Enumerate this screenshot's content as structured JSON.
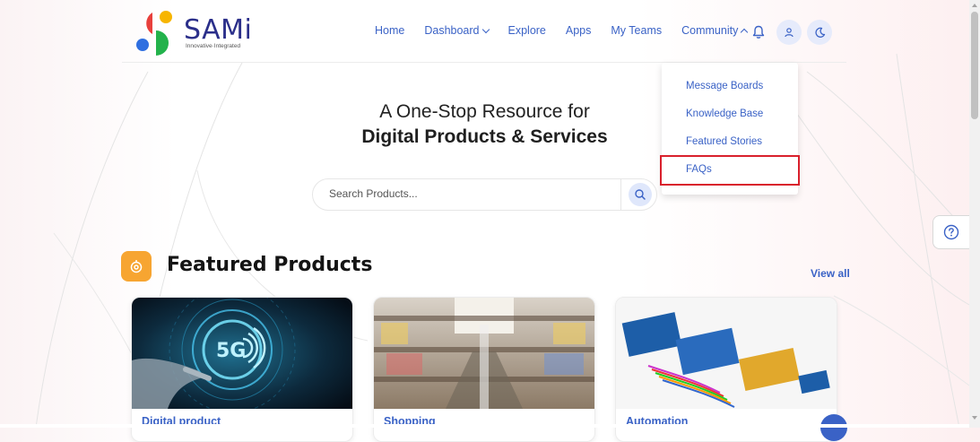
{
  "brand": {
    "name": "SAMi",
    "tagline": "Innovative·Integrated"
  },
  "nav": {
    "items": [
      {
        "label": "Home",
        "chevron": ""
      },
      {
        "label": "Dashboard",
        "chevron": "down"
      },
      {
        "label": "Explore",
        "chevron": ""
      },
      {
        "label": "Apps",
        "chevron": ""
      },
      {
        "label": "My Teams",
        "chevron": ""
      },
      {
        "label": "Community",
        "chevron": "up"
      }
    ],
    "icons": [
      "bell-icon",
      "user-icon",
      "moon-icon"
    ]
  },
  "community_menu": {
    "items": [
      "Message Boards",
      "Knowledge Base",
      "Featured Stories",
      "FAQs"
    ],
    "highlighted": "FAQs"
  },
  "hero": {
    "line1": "A One-Stop Resource for",
    "line2": "Digital Products & Services"
  },
  "search": {
    "placeholder": "Search Products...",
    "value": ""
  },
  "featured": {
    "title": "Featured Products",
    "view_all": "View all",
    "cards": [
      {
        "title": "Digital product",
        "image": "5g-hand-image"
      },
      {
        "title": "Shopping",
        "image": "shopping-mall-image"
      },
      {
        "title": "Automation",
        "image": "circuit-boards-image"
      }
    ]
  },
  "colors": {
    "accent": "#3a62c6",
    "brand_text": "#2b2f8a",
    "highlight_border": "#d9202c",
    "featured_icon_bg": "#f7a531",
    "logo_red": "#e8403c",
    "logo_yellow": "#f7b500",
    "logo_blue": "#2f6fe0",
    "logo_green": "#23b24b"
  }
}
